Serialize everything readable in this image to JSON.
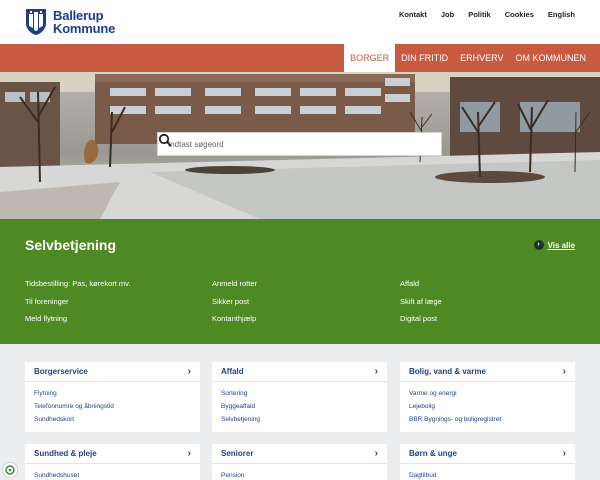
{
  "header": {
    "logo_line1": "Ballerup",
    "logo_line2": "Kommune",
    "top_links": [
      "Kontakt",
      "Job",
      "Politik",
      "Cookies",
      "English"
    ]
  },
  "nav": {
    "items": [
      "BORGER",
      "DIN FRITID",
      "ERHVERV",
      "OM KOMMUNEN"
    ],
    "active": "BORGER"
  },
  "search": {
    "placeholder": "Indtast søgeord",
    "icon": "search-icon"
  },
  "self_service": {
    "title": "Selvbetjening",
    "see_all": "Vis alle",
    "columns": [
      [
        "Tidsbestilling: Pas, kørekort mv.",
        "Til foreninger",
        "Meld flytning"
      ],
      [
        "Anmeld rotter",
        "Sikker post",
        "Kontanthjælp"
      ],
      [
        "Affald",
        "Skift af læge",
        "Digital post"
      ]
    ]
  },
  "cards": [
    {
      "title": "Borgerservice",
      "links": [
        "Flytning",
        "Telefonnumre og åbningstid",
        "Sundhedskort"
      ]
    },
    {
      "title": "Affald",
      "links": [
        "Sortering",
        "Byggeaffald",
        "Selvbetjening"
      ]
    },
    {
      "title": "Bolig, vand & varme",
      "links": [
        "Varme og energi",
        "Lejebolig",
        "BBR Bygnings- og boligregistret"
      ]
    },
    {
      "title": "Sundhed & pleje",
      "links": [
        "Sundhedshuset"
      ]
    },
    {
      "title": "Seniorer",
      "links": [
        "Pension"
      ]
    },
    {
      "title": "Børn & unge",
      "links": [
        "Dagtilbud"
      ]
    }
  ],
  "colors": {
    "brand_blue": "#1f3b8c",
    "nav_orange": "#c75a3f",
    "self_service_green": "#4e8a23",
    "link_blue": "#23428a"
  }
}
